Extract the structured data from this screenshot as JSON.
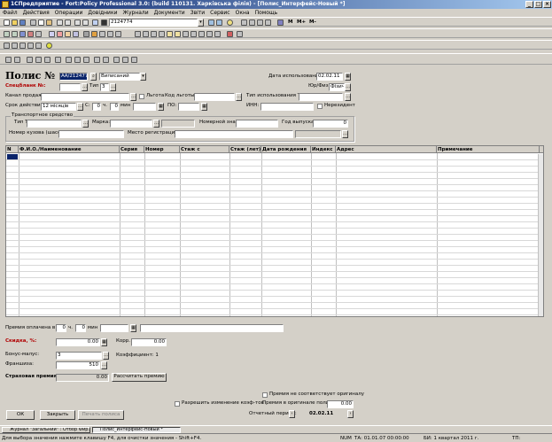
{
  "window": {
    "title": "1СПредприятие - Fort:Policy Professional 3.0: (build 110131. Харківська філія) - [Полис_Интерфейс-Новый *]",
    "min_label": "_",
    "restore_label": "□",
    "close_label": "×"
  },
  "menu": [
    "Файл",
    "Действия",
    "Операции",
    "Довідники",
    "Журнали",
    "Документи",
    "Звіти",
    "Сервис",
    "Окна",
    "Помощь"
  ],
  "toolbar": {
    "search_value": "2124774"
  },
  "form": {
    "title": "Полис №",
    "polis_number": "АА/2124774",
    "status_value": "Виписаний",
    "tip_label": "Тип",
    "tip_value": "3",
    "date_use_label": "Дата использования:",
    "date_use_value": "02.02.11",
    "special_label": "Спецбланк №:",
    "yur_fiz_label": "Юр/Физ:",
    "yur_fiz_value": "Фізич",
    "channel_label": "Канал продаж:",
    "lgota_label": "Льгота",
    "lgota_code_label": "Код льготы:",
    "tip_use_label": "Тип использования ТС:",
    "srok_label": "Срок действия:",
    "srok_value": "12 місяців",
    "c_label": "С:",
    "c_value": "0",
    "ch_label": "ч.",
    "min_value": "0",
    "min_label": "мин",
    "po_label": "ПО:",
    "inn_label": "ИНН:",
    "nerezident_label": "Нерезидент",
    "ts_group_label": "Транспортное средство",
    "tip_ts_label": "Тип ТС:",
    "marka_label": "Марка:",
    "nomer_label": "Номерной знак:",
    "god_label": "Год выпуска:",
    "god_value": "0",
    "kuzov_label": "Номер кузова (шасси):",
    "mesto_label": "Место регистрации:"
  },
  "grid": {
    "columns": [
      "N",
      "Ф.И.О./Наименование",
      "Серия",
      "Номер",
      "Стаж с",
      "Стаж (лет)",
      "Дата рождения",
      "Индекс",
      "Адрес",
      "Примечание"
    ]
  },
  "bottom": {
    "premiya_label": "Премия оплачена в",
    "premiya_ch": "0",
    "ch_label": "ч.",
    "premiya_min": "0",
    "min_label": "мин",
    "skidka_label": "Скидка, %:",
    "skidka_value": "0.00",
    "korr_label": "Корр.",
    "korr_value": "0.00",
    "bonus_label": "Бонус-малус:",
    "bonus_value": "3",
    "koef_label": "Коэффициент: 1",
    "franshiza_label": "Франшиза:",
    "franshiza_value": "510",
    "strah_label": "Страховая премия:",
    "strah_value": "0.00",
    "calc_button": "Рассчитать премию",
    "ne_sootv_label": "Премия не соответствует оригиналу",
    "razreshit_label": "Разрешить изменение коэф-тов",
    "premiya_orig_label": "Премия в оригинале полиса:",
    "premiya_orig_value": "0.00",
    "otchet_label": "Отчетный период:",
    "otchet_value": "02.02.11",
    "ok_button": "ОК",
    "close_button": "Закрыть",
    "print_button": "Печать полиса"
  },
  "taskbar": {
    "items": [
      "Журнал \"Загальний\" : Отбор Фир...",
      "Полис_Интерфейс-Новый *"
    ]
  },
  "status": {
    "hint": "Для выбора значения нажмите клавишу F4, для очистки значения - Shift+F4.",
    "num": "NUM",
    "ta": "ТА: 01.01.07 00:00:00",
    "bi": "БИ: 1 квартал 2011 г.",
    "tp": "ТП:"
  }
}
